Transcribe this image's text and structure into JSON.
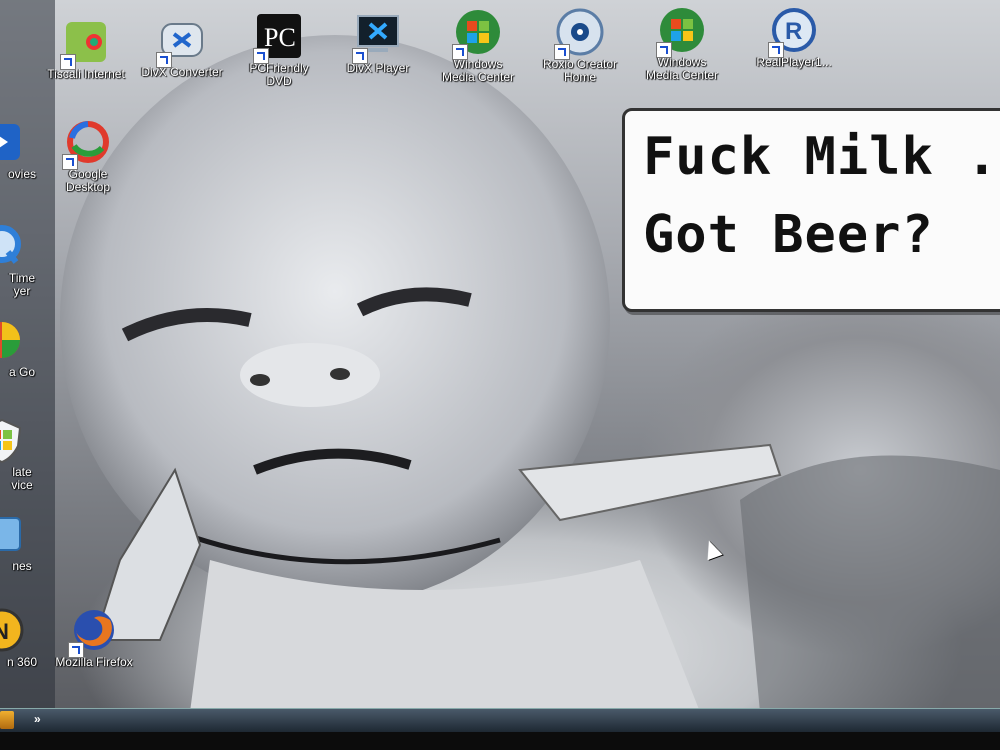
{
  "desktop": {
    "top_icons": [
      {
        "label": "Tiscali Internet",
        "icon": "tiscali-icon"
      },
      {
        "label": "DivX Converter",
        "icon": "divx-converter-icon"
      },
      {
        "label": "PCFriendly DVD",
        "icon": "pcfriendly-icon"
      },
      {
        "label": "DivX Player",
        "icon": "divx-player-icon"
      },
      {
        "label": "Windows Media Center",
        "icon": "windows-media-center-icon"
      },
      {
        "label": "Roxio Creator Home",
        "icon": "roxio-icon"
      },
      {
        "label": "Windows Media Center",
        "icon": "windows-media-center-icon"
      },
      {
        "label": "RealPlayer1...",
        "icon": "realplayer-icon"
      }
    ],
    "left_icons": [
      {
        "label": "ovies",
        "icon": "movies-icon"
      },
      {
        "label": "Time\nyer",
        "icon": "quicktime-icon"
      },
      {
        "label": "a Go",
        "icon": "app-icon"
      },
      {
        "label": "late\nvice",
        "icon": "shield-icon"
      },
      {
        "label": "nes",
        "icon": "app-icon"
      },
      {
        "label": "n 360",
        "icon": "norton-icon"
      }
    ],
    "column_icons": [
      {
        "label": "Google Desktop",
        "icon": "google-desktop-icon"
      },
      {
        "label": "Mozilla Firefox",
        "icon": "firefox-icon"
      }
    ]
  },
  "wallpaper": {
    "caption_line1": "Fuck Milk .",
    "caption_line2": "Got Beer?"
  },
  "taskbar": {
    "chevron": "»"
  }
}
